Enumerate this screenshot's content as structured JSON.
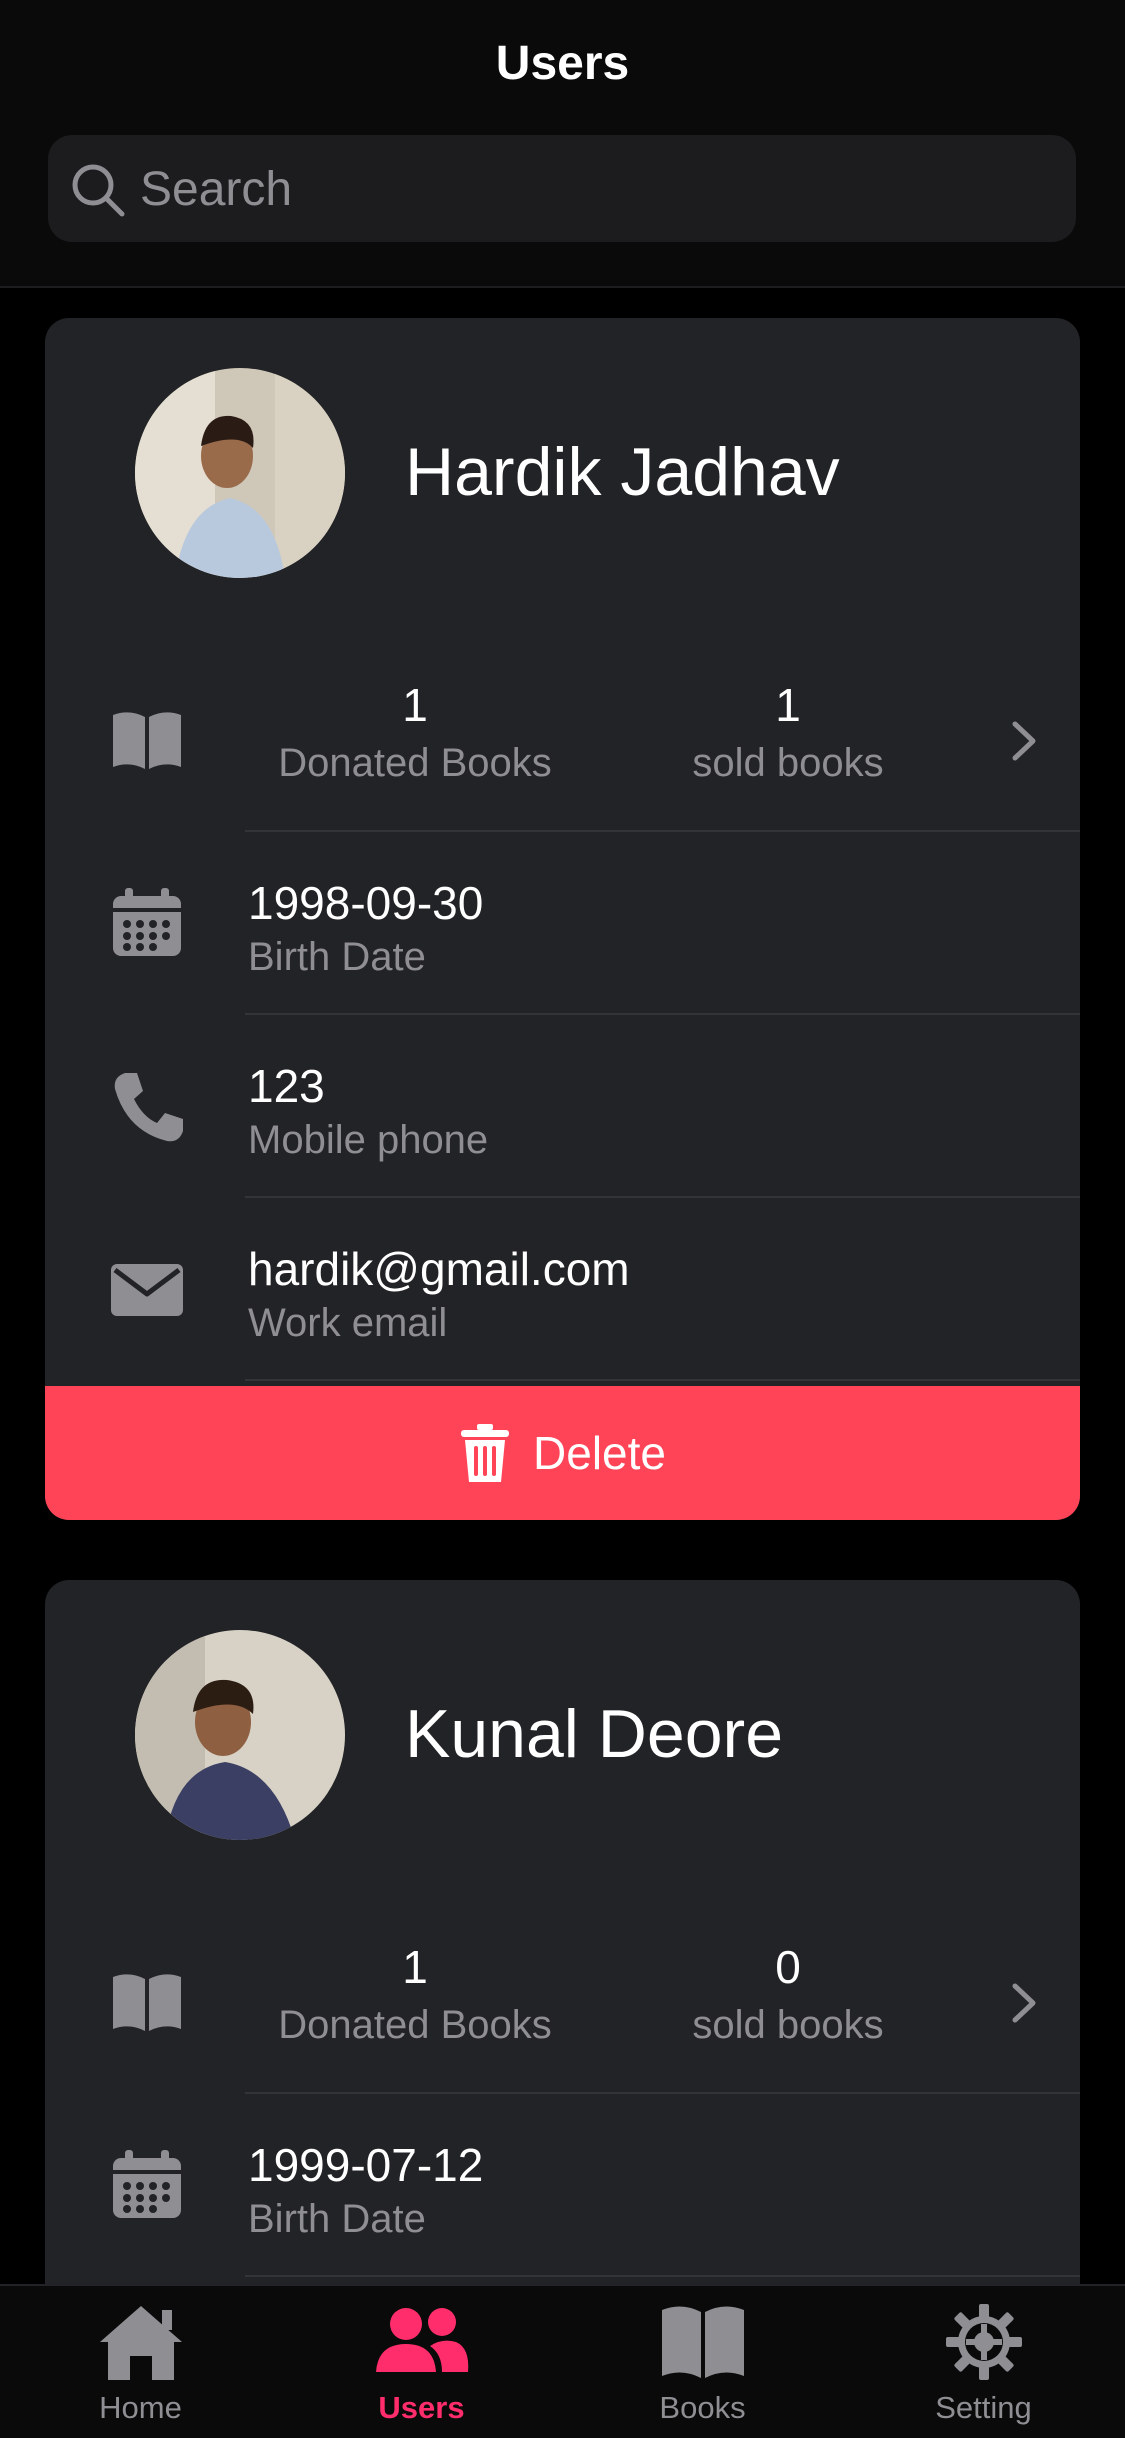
{
  "header": {
    "title": "Users"
  },
  "search": {
    "placeholder": "Search"
  },
  "users": [
    {
      "name": "Hardik Jadhav",
      "donated": "1",
      "donated_label": "Donated Books",
      "sold": "1",
      "sold_label": "sold books",
      "birth_date": "1998-09-30",
      "birth_label": "Birth Date",
      "phone": "123",
      "phone_label": "Mobile phone",
      "email": "hardik@gmail.com",
      "email_label": "Work email",
      "delete_label": "Delete"
    },
    {
      "name": "Kunal Deore",
      "donated": "1",
      "donated_label": "Donated Books",
      "sold": "0",
      "sold_label": "sold books",
      "birth_date": "1999-07-12",
      "birth_label": "Birth Date"
    }
  ],
  "tabs": [
    {
      "label": "Home",
      "icon": "home-icon",
      "active": false
    },
    {
      "label": "Users",
      "icon": "users-icon",
      "active": true
    },
    {
      "label": "Books",
      "icon": "book-icon",
      "active": false
    },
    {
      "label": "Setting",
      "icon": "gear-icon",
      "active": false
    }
  ],
  "colors": {
    "accent": "#ff2d6b",
    "delete": "#ff4458",
    "card": "#222326",
    "muted": "#8e8e93"
  }
}
